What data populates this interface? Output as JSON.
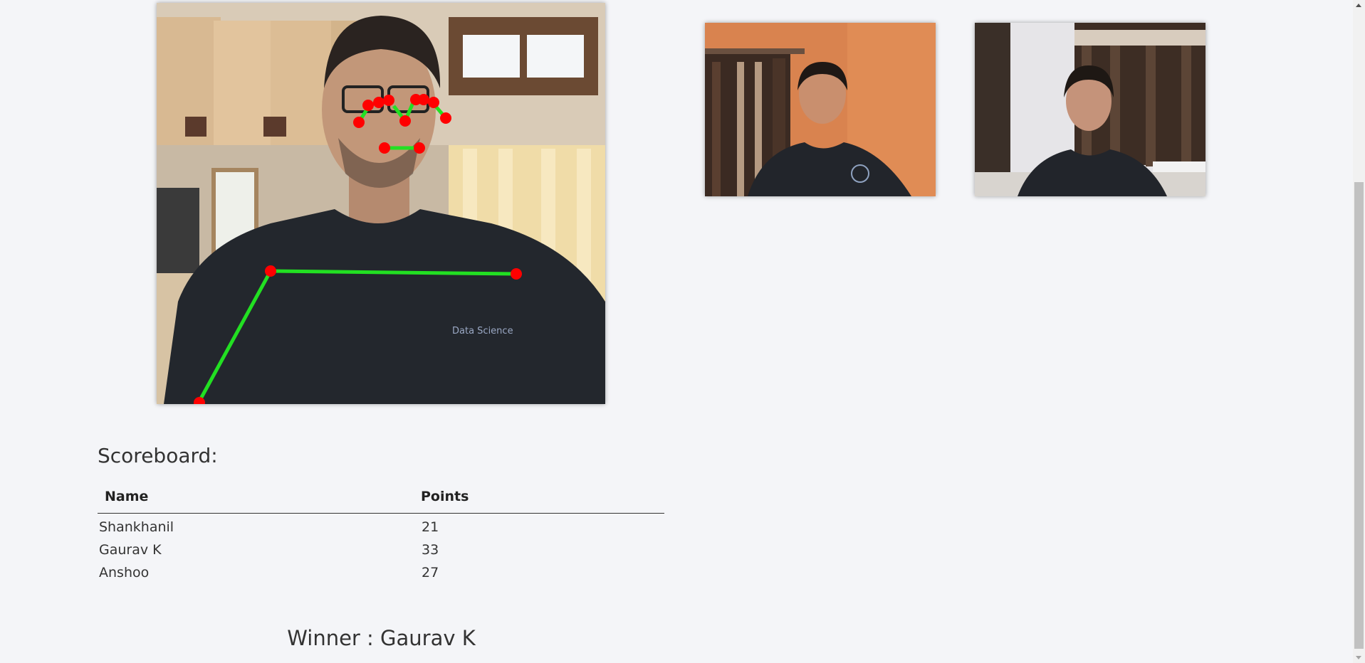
{
  "scoreboard": {
    "heading": "Scoreboard:",
    "columns": {
      "name": "Name",
      "points": "Points"
    },
    "rows": [
      {
        "name": "Shankhanil",
        "points": "21"
      },
      {
        "name": "Gaurav K",
        "points": "33"
      },
      {
        "name": "Anshoo",
        "points": "27"
      }
    ]
  },
  "winner": {
    "text": "Winner : Gaurav K"
  },
  "videos": {
    "local": {
      "shirt_text": "Data Science",
      "pose_color": "#22e022",
      "keypoint_color": "#ff0000"
    },
    "remote_1": {},
    "remote_2": {}
  },
  "colors": {
    "background": "#f4f5f8",
    "text": "#333333"
  }
}
